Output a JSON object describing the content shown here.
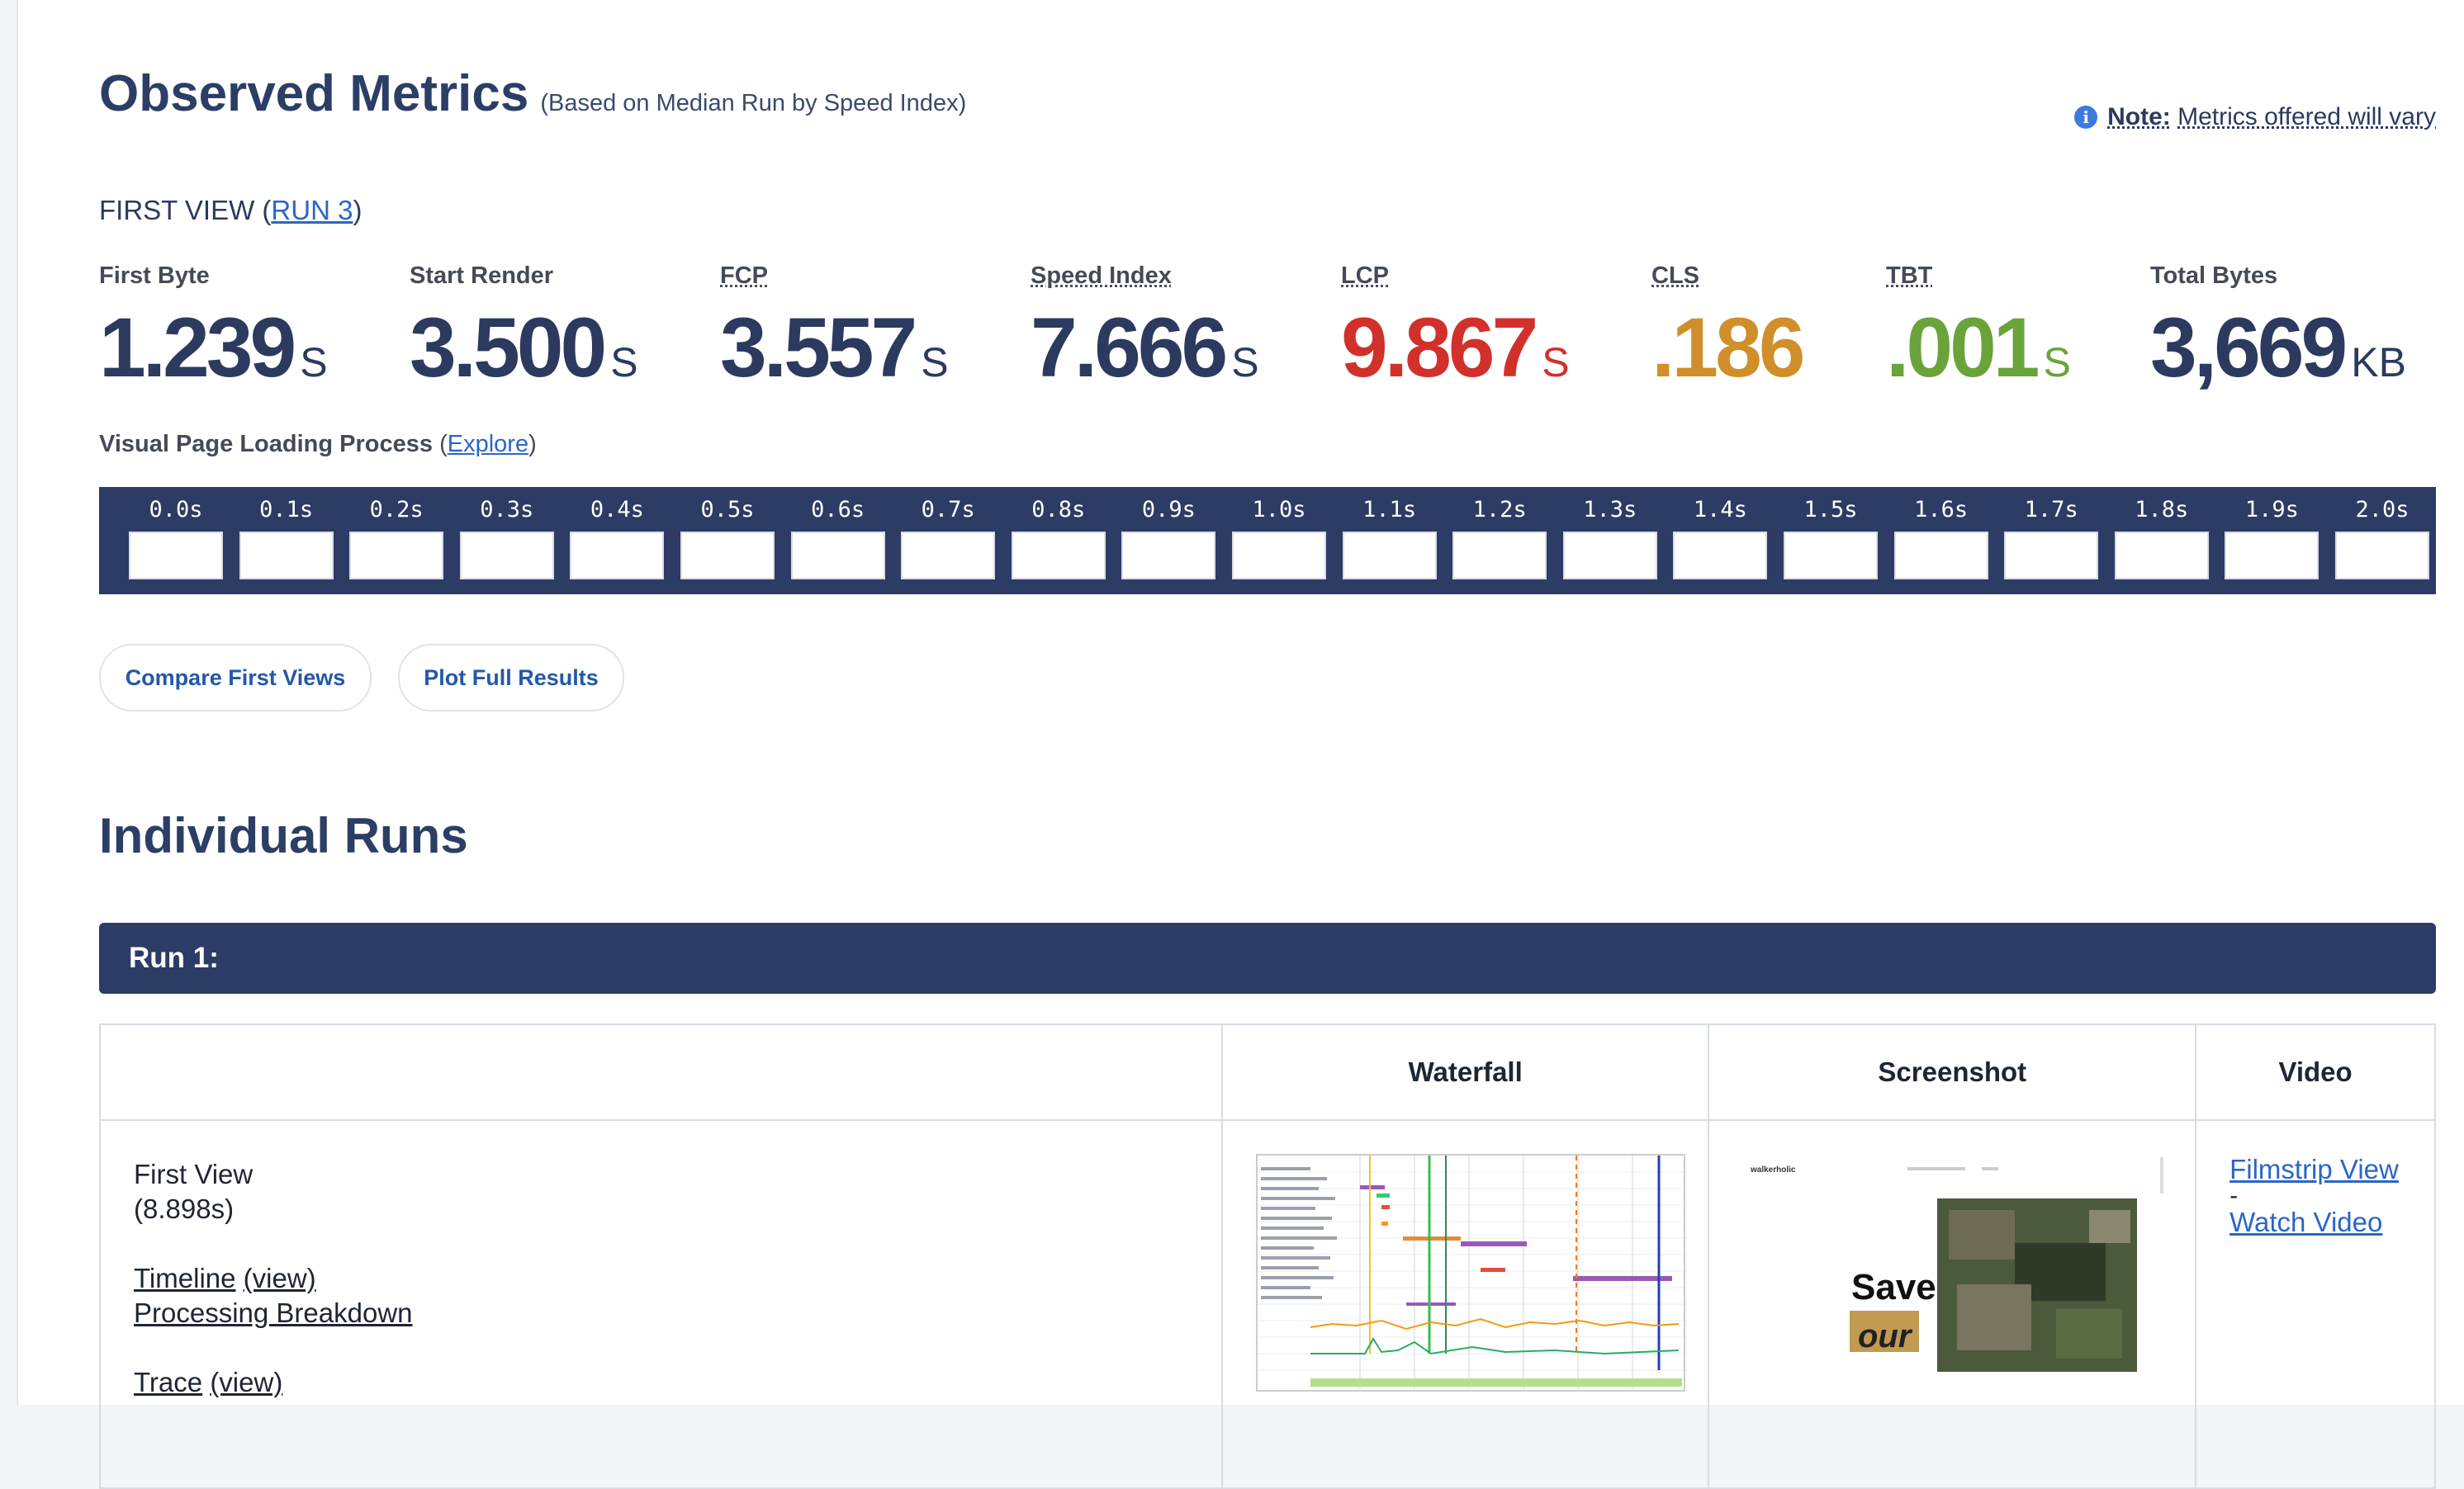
{
  "header": {
    "title": "Observed Metrics",
    "subtitle": "(Based on Median Run by Speed Index)",
    "note_bold": "Note:",
    "note_text": "Metrics offered will vary"
  },
  "first_view": {
    "prefix": "FIRST VIEW (",
    "run_link": "RUN 3",
    "suffix": ")"
  },
  "metrics": [
    {
      "label": "First Byte",
      "value": "1.239",
      "unit": "S",
      "color": "#2c3e66"
    },
    {
      "label": "Start Render",
      "value": "3.500",
      "unit": "S",
      "color": "#2c3e66"
    },
    {
      "label": "FCP",
      "value": "3.557",
      "unit": "S",
      "color": "#2c3e66"
    },
    {
      "label": "Speed Index",
      "value": "7.666",
      "unit": "S",
      "color": "#2c3e66"
    },
    {
      "label": "LCP",
      "value": "9.867",
      "unit": "S",
      "color": "#d2302b"
    },
    {
      "label": "CLS",
      "value": ".186",
      "unit": "",
      "color": "#d08f2b"
    },
    {
      "label": "TBT",
      "value": ".001",
      "unit": "S",
      "color": "#6aa33a"
    },
    {
      "label": "Total Bytes",
      "value": "3,669",
      "unit": "KB",
      "color": "#2c3e66"
    }
  ],
  "visual_loading": {
    "label": "Visual Page Loading Process",
    "open": "(",
    "link": "Explore",
    "close": ")"
  },
  "filmstrip_times": [
    "0.0s",
    "0.1s",
    "0.2s",
    "0.3s",
    "0.4s",
    "0.5s",
    "0.6s",
    "0.7s",
    "0.8s",
    "0.9s",
    "1.0s",
    "1.1s",
    "1.2s",
    "1.3s",
    "1.4s",
    "1.5s",
    "1.6s",
    "1.7s",
    "1.8s",
    "1.9s",
    "2.0s"
  ],
  "buttons": {
    "compare": "Compare First Views",
    "plot": "Plot Full Results"
  },
  "individual_runs": {
    "title": "Individual Runs",
    "run_label": "Run 1:"
  },
  "table": {
    "headers": {
      "blank": "",
      "waterfall": "Waterfall",
      "screenshot": "Screenshot",
      "video": "Video"
    },
    "first_view_label": "First View",
    "first_view_time": "(8.898s)",
    "timeline": "Timeline",
    "timeline_view": "(view)",
    "processing": "Processing Breakdown",
    "trace": "Trace",
    "trace_view": "(view)",
    "filmstrip_view": "Filmstrip View",
    "dash": "-",
    "watch_video": "Watch Video"
  },
  "screenshot_text": {
    "brand": "walkerholic",
    "save": "Save",
    "our": "our"
  },
  "colors": {
    "navy": "#2d3c65",
    "link": "#2a66c9",
    "lcp": "#d2302b",
    "cls": "#d08f2b",
    "tbt": "#6aa33a"
  },
  "icons": [
    "info-icon"
  ]
}
